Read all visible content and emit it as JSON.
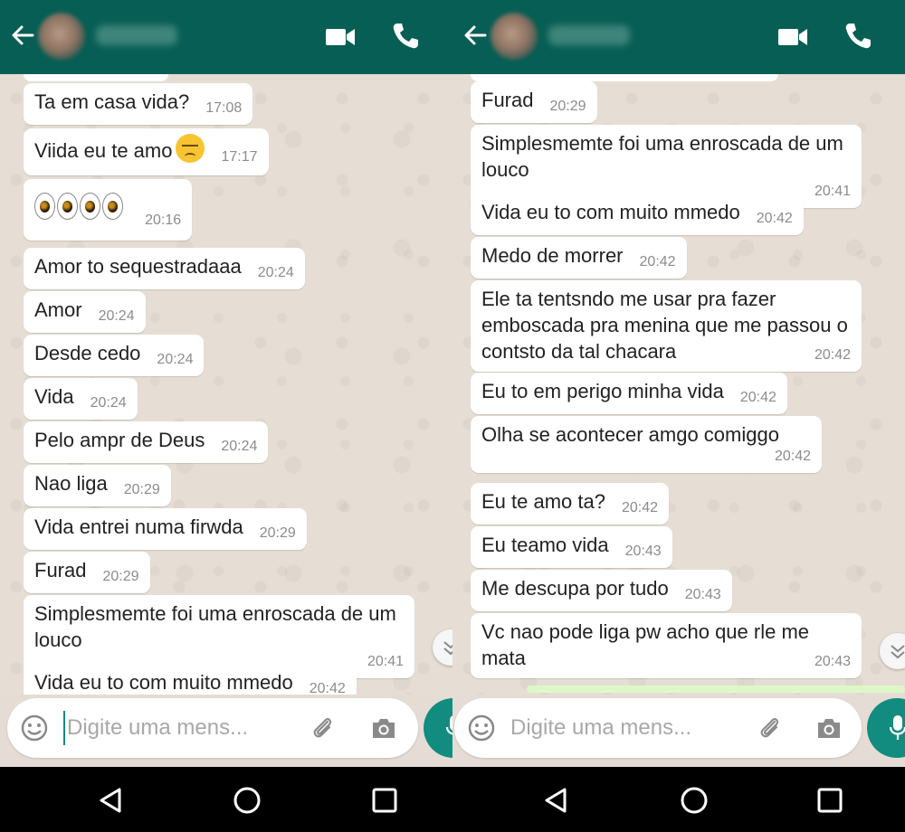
{
  "input_placeholder": "Digite uma mens...",
  "colors": {
    "header": "#075e54",
    "bubble": "#ffffff",
    "chat_bg": "#e6ded4",
    "mic": "#128c7e",
    "outgoing": "#dcf8c6"
  },
  "icons": [
    "back-arrow-icon",
    "video-call-icon",
    "phone-icon",
    "emoji-icon",
    "attach-icon",
    "camera-icon",
    "mic-icon",
    "nav-back-icon",
    "nav-home-icon",
    "nav-recents-icon",
    "scroll-down-icon"
  ],
  "left": {
    "messages": [
      {
        "text": "Ta em casa vida?",
        "time": "17:08"
      },
      {
        "text": "Viida eu te amo",
        "time": "17:17"
      },
      {
        "text": "",
        "time": "20:16"
      },
      {
        "text": "Amor to sequestradaaa",
        "time": "20:24"
      },
      {
        "text": "Amor",
        "time": "20:24"
      },
      {
        "text": "Desde cedo",
        "time": "20:24"
      },
      {
        "text": "Vida",
        "time": "20:24"
      },
      {
        "text": "Pelo ampr de Deus",
        "time": "20:24"
      },
      {
        "text": "Nao liga",
        "time": "20:29"
      },
      {
        "text": "Vida entrei numa firwda",
        "time": "20:29"
      },
      {
        "text": "Furad",
        "time": "20:29"
      },
      {
        "text": "Simplesmemte foi uma enroscada de um louco",
        "time": "20:41"
      },
      {
        "text": "Vida eu to com muito mmedo",
        "time": "20:42"
      }
    ]
  },
  "right": {
    "messages": [
      {
        "text": "Furad",
        "time": "20:29"
      },
      {
        "text": "Simplesmemte foi uma enroscada de um louco",
        "time": "20:41"
      },
      {
        "text": "Vida eu to com muito mmedo",
        "time": "20:42"
      },
      {
        "text": "Medo de morrer",
        "time": "20:42"
      },
      {
        "text": "Ele ta tentsndo me usar pra fazer emboscada pra menina que me passou o contsto da tal chacara",
        "time": "20:42"
      },
      {
        "text": "Eu to em perigo minha vida",
        "time": "20:42"
      },
      {
        "text": "Olha se acontecer amgo comiggo",
        "time": "20:42"
      },
      {
        "text": "Eu te amo ta?",
        "time": "20:42"
      },
      {
        "text": "Eu teamo vida",
        "time": "20:43"
      },
      {
        "text": "Me descupa por tudo",
        "time": "20:43"
      },
      {
        "text": "Vc nao pode liga pw acho que rle me mata",
        "time": "20:43"
      }
    ]
  }
}
